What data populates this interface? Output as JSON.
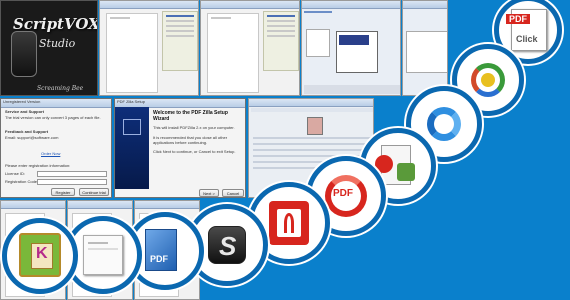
{
  "logo": {
    "title": "ScriptVOX",
    "subtitle": "Studio",
    "brand": "Screaming Bee"
  },
  "setup_wizard": {
    "window_title": "PDF Zilla Setup",
    "heading": "Welcome to the PDF Zilla Setup Wizard",
    "body_1": "This will install PDFZilla 2.x on your computer.",
    "body_2": "It is recommended that you close all other applications before continuing.",
    "body_3": "Click Next to continue, or Cancel to exit Setup.",
    "next_label": "Next >",
    "cancel_label": "Cancel"
  },
  "reg_dialog": {
    "window_title": "Unregistered Version",
    "section_1": "Service and Support",
    "notice": "The trial version can only convert 3 pages of each file.",
    "section_2": "Feedback and Support",
    "support_text": "Email: support@software.com",
    "link_text": "Order Now",
    "prompt": "Please enter registration information:",
    "license_label": "License ID:",
    "code_label": "Registration Code:",
    "register_label": "Register",
    "trial_label": "Continue trial"
  },
  "icons": [
    {
      "name": "pdf-click-icon",
      "text": "PDF",
      "text2": "Click"
    },
    {
      "name": "color-orbit-icon"
    },
    {
      "name": "refresh-arrows-icon"
    },
    {
      "name": "pdf-converter-icon"
    },
    {
      "name": "pdf-circle-arrow-icon",
      "text": "PDF"
    },
    {
      "name": "pdf-writer-icon"
    },
    {
      "name": "s-logo-icon",
      "text": "S"
    },
    {
      "name": "pdf-cube-icon",
      "text": "PDF"
    },
    {
      "name": "blank-document-icon"
    },
    {
      "name": "book-box-icon",
      "text": "K"
    }
  ],
  "colors": {
    "background": "#0a80cc",
    "ring": "#0a68b0",
    "pdf_red": "#d7261e"
  }
}
